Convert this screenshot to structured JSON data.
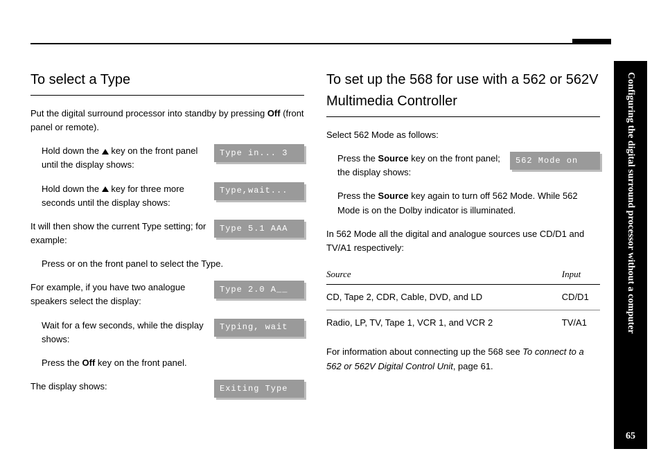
{
  "side": {
    "chapter": "Configuring the digital surround processor without a computer",
    "page": "65"
  },
  "left": {
    "title": "To select a Type",
    "p1a": "Put the digital surround processor into standby by pressing ",
    "p1b": "Off",
    "p1c": " (front panel or remote).",
    "r1a": "Hold down the ",
    "r1b": " key on the front panel until the display shows:",
    "lcd1": "Type in... 3",
    "r2a": "Hold down the ",
    "r2b": " key for three more seconds until the display shows:",
    "lcd2": "Type,wait...",
    "r3": "It will then show the current Type setting; for example:",
    "lcd3": "Type 5.1 AAA",
    "p2": "Press     or     on the front panel to select the Type.",
    "r4": "For example, if you have two analogue speakers select the display:",
    "lcd4": "Type 2.0 A__",
    "r5": "Wait for a few seconds, while the display shows:",
    "lcd5": "Typing, wait",
    "p3a": "Press the ",
    "p3b": "Off",
    "p3c": " key on the front panel.",
    "r6": "The display shows:",
    "lcd6": "Exiting Type"
  },
  "right": {
    "title": "To set up the 568 for use with a 562 or 562V Multimedia Controller",
    "p1": "Select 562 Mode as follows:",
    "r1a": "Press the ",
    "r1b": "Source",
    "r1c": " key on the front panel; the display shows:",
    "lcd1": "562 Mode on",
    "p2a": "Press the ",
    "p2b": "Source",
    "p2c": " key again to turn off 562 Mode. While 562 Mode is on the Dolby indicator is illuminated.",
    "p3": "In 562 Mode all the digital and analogue sources use CD/D1 and TV/A1 respectively:",
    "table": {
      "h1": "Source",
      "h2": "Input",
      "r1c1": "CD, Tape 2, CDR, Cable, DVD, and LD",
      "r1c2": "CD/D1",
      "r2c1": "Radio, LP, TV, Tape 1, VCR 1, and VCR 2",
      "r2c2": "TV/A1"
    },
    "p4a": "For information about connecting up the 568 see ",
    "p4b": "To connect to a 562 or 562V Digital Control Unit",
    "p4c": ", page 61."
  }
}
